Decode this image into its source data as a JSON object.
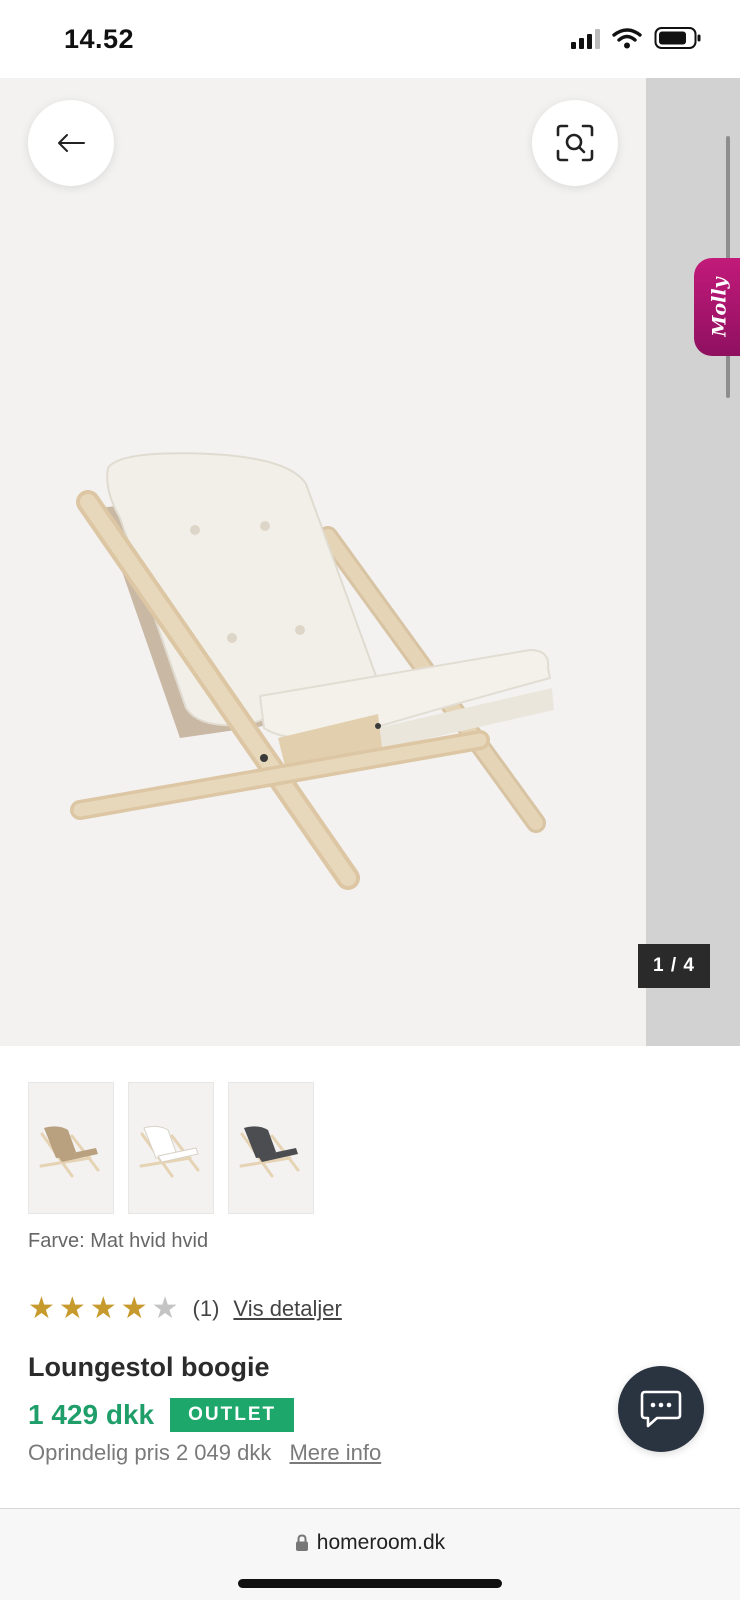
{
  "status_bar": {
    "time": "14.52",
    "icons": [
      "signal-icon",
      "wifi-icon",
      "battery-icon"
    ]
  },
  "gallery": {
    "counter": "1 / 4",
    "back_icon": "back-arrow-icon",
    "lens_icon": "visual-search-icon",
    "side_tab_label": "Molly",
    "image": "chair-photo"
  },
  "variants": [
    {
      "color": "#b9a180",
      "name": "beige-variant"
    },
    {
      "color": "#eceae5",
      "name": "white-variant"
    },
    {
      "color": "#4b4d50",
      "name": "dark-grey-variant"
    }
  ],
  "color_label": "Farve: Mat hvid hvid",
  "rating": {
    "stars": 4,
    "max": 5,
    "count_text": "(1)",
    "details_link": "Vis detaljer"
  },
  "product": {
    "title": "Loungestol boogie",
    "price": "1 429 dkk",
    "badge": "OUTLET",
    "original_price": "Oprindelig pris 2 049 dkk",
    "more_info": "Mere info"
  },
  "chat_icon": "chat-icon",
  "address_bar": {
    "url": "homeroom.dk",
    "lock_icon": "lock-icon"
  },
  "colors": {
    "accent_green": "#1f9e6a",
    "badge_green": "#1ea76a",
    "star_gold": "#c69a2c",
    "chat_bg": "#2a3340",
    "molly": "#c21a7a"
  }
}
